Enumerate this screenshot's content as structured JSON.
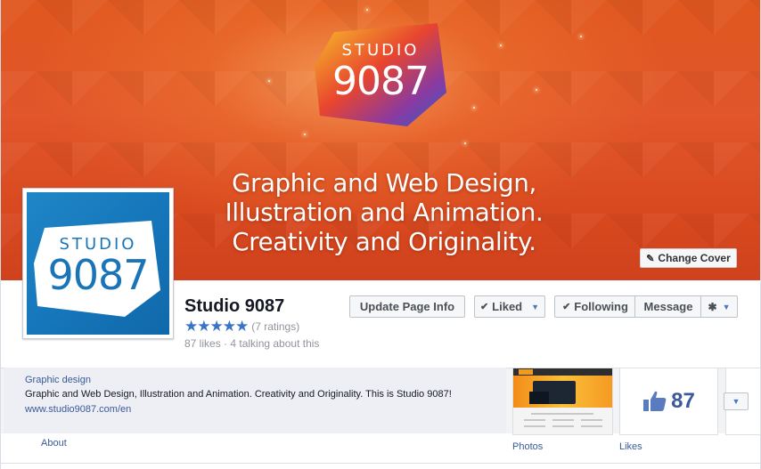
{
  "cover": {
    "logo_top": "STUDIO",
    "logo_bottom": "9087",
    "tagline": [
      "Graphic and Web Design,",
      "Illustration and Animation.",
      "Creativity and Originality."
    ],
    "change_cover_label": "Change Cover"
  },
  "profile": {
    "logo_top": "STUDIO",
    "logo_bottom": "9087"
  },
  "page": {
    "name": "Studio 9087",
    "stars": "★★★★★",
    "ratings": "(7 ratings)",
    "stats": "87 likes · 4 talking about this"
  },
  "actions": {
    "update_info": "Update Page Info",
    "liked": "Liked",
    "following": "Following",
    "message": "Message"
  },
  "about": {
    "category": "Graphic design",
    "description": "Graphic and Web Design, Illustration and Animation. Creativity and Originality. This is Studio 9087!",
    "url": "www.studio9087.com/en",
    "label": "About"
  },
  "tiles": {
    "photos_label": "Photos",
    "likes_count": "87",
    "likes_label": "Likes"
  },
  "icons": {
    "pencil": "pencil-icon",
    "check": "check-icon",
    "caret": "caret-down-icon",
    "gear": "gear-icon",
    "thumb": "thumbs-up-icon"
  },
  "colors": {
    "cover_orange": "#e1562a",
    "link_blue": "#3b5998",
    "profile_blue": "#1677bb",
    "star_blue": "#3b73c8"
  }
}
